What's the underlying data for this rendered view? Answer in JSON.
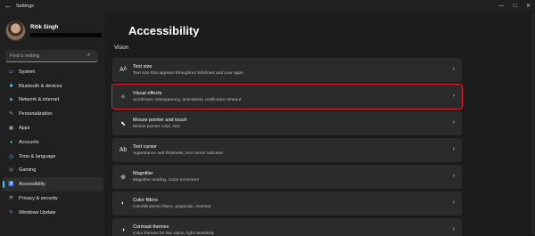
{
  "window": {
    "title": "Settings",
    "back_icon": "←",
    "minimize_icon": "—",
    "maximize_icon": "□",
    "close_icon": "✕"
  },
  "profile": {
    "name": "Ritik Singh"
  },
  "search": {
    "placeholder": "Find a setting",
    "icon": "⌕"
  },
  "nav": {
    "items": [
      {
        "label": "System",
        "icon": "▭",
        "active": false
      },
      {
        "label": "Bluetooth & devices",
        "icon": "✱",
        "active": false
      },
      {
        "label": "Network & internet",
        "icon": "◈",
        "active": false
      },
      {
        "label": "Personalization",
        "icon": "✎",
        "active": false
      },
      {
        "label": "Apps",
        "icon": "▦",
        "active": false
      },
      {
        "label": "Accounts",
        "icon": "●",
        "active": false
      },
      {
        "label": "Time & language",
        "icon": "◷",
        "active": false
      },
      {
        "label": "Gaming",
        "icon": "◎",
        "active": false
      },
      {
        "label": "Accessibility",
        "icon": "♿",
        "active": true
      },
      {
        "label": "Privacy & security",
        "icon": "⛨",
        "active": false
      },
      {
        "label": "Windows Update",
        "icon": "↻",
        "active": false
      }
    ]
  },
  "main": {
    "title": "Accessibility",
    "section": "Vision",
    "chevron": "›",
    "cards": [
      {
        "title": "Text size",
        "desc": "Text size that appears throughout Windows and your apps",
        "icon": "Aᴬ",
        "highlighted": false
      },
      {
        "title": "Visual effects",
        "desc": "Scroll bars, transparency, animations, notification timeout",
        "icon": "✧",
        "highlighted": true
      },
      {
        "title": "Mouse pointer and touch",
        "desc": "Mouse pointer color, size",
        "icon": "⬉",
        "highlighted": false
      },
      {
        "title": "Text cursor",
        "desc": "Appearance and thickness, text cursor indicator",
        "icon": "Ab",
        "highlighted": false
      },
      {
        "title": "Magnifier",
        "desc": "Magnifier reading, zoom increment",
        "icon": "⊕",
        "highlighted": false
      },
      {
        "title": "Color filters",
        "desc": "Colorblindness filters, grayscale, inverted",
        "icon": "◐",
        "highlighted": false
      },
      {
        "title": "Contrast themes",
        "desc": "Color themes for low vision, light sensitivity",
        "icon": "◑",
        "highlighted": false
      }
    ]
  },
  "colors": {
    "accent": "#4cc2ff",
    "highlight_border": "#e0202a",
    "background": "#1c1c1c",
    "card": "#2b2b2b"
  }
}
